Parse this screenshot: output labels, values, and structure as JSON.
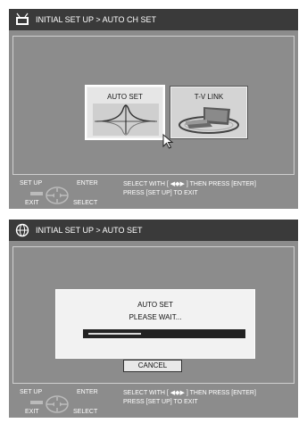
{
  "screen1": {
    "title": "INITIAL SET UP > AUTO CH SET",
    "title_icon": "tv-icon",
    "tiles": [
      {
        "label": "AUTO SET",
        "icon": "signal-waveform-icon",
        "selected": true
      },
      {
        "label": "T-V LINK",
        "icon": "tv-vcr-link-icon",
        "selected": false
      }
    ],
    "footer": {
      "setup": "SET UP",
      "enter": "ENTER",
      "exit": "EXIT",
      "select": "SELECT",
      "line1": "SELECT WITH [ ◀◆▶ ] THEN PRESS [ENTER]",
      "line2": "PRESS [SET UP] TO EXIT"
    }
  },
  "screen2": {
    "title": "INITIAL SET UP > AUTO SET",
    "title_icon": "globe-icon",
    "dialog": {
      "line1": "AUTO SET",
      "line2": "PLEASE WAIT...",
      "progress": 0.35
    },
    "cancel_label": "CANCEL",
    "footer": {
      "setup": "SET UP",
      "enter": "ENTER",
      "exit": "EXIT",
      "select": "SELECT",
      "line1": "SELECT WITH [ ◀◆▶ ] THEN PRESS [ENTER]",
      "line2": "PRESS [SET UP] TO EXIT"
    }
  }
}
